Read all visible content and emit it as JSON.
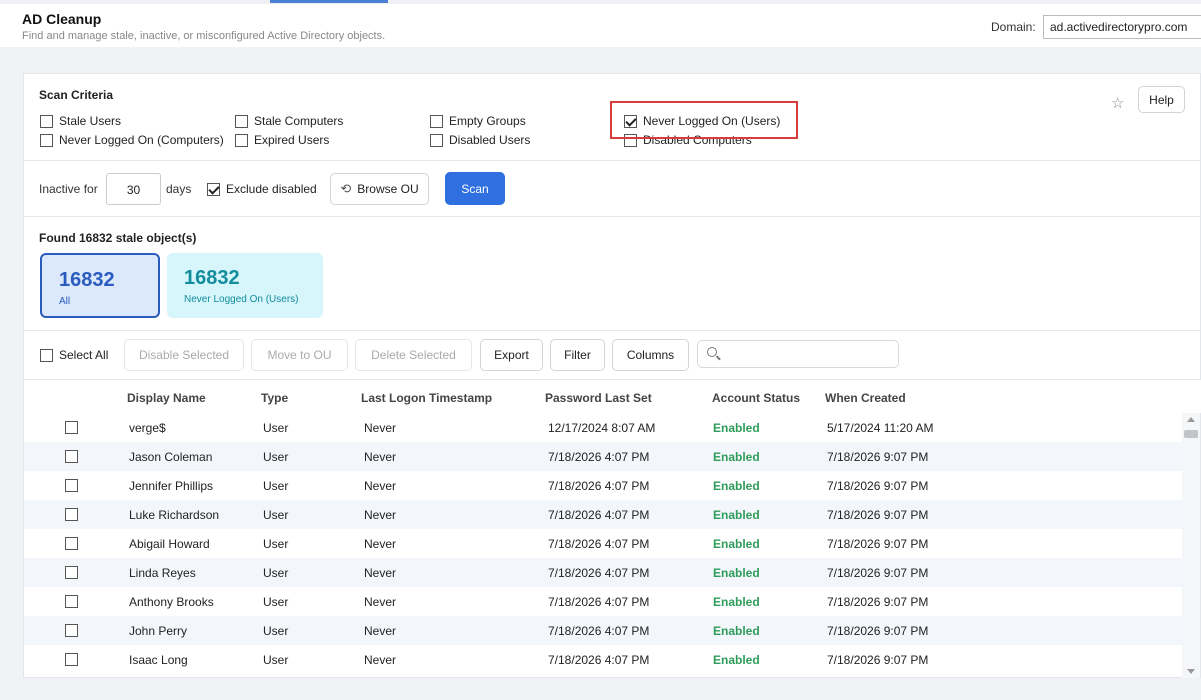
{
  "header": {
    "title": "AD Cleanup",
    "subtitle": "Find and manage stale, inactive, or misconfigured Active Directory objects.",
    "domain_label": "Domain:",
    "domain_value": "ad.activedirectorypro.com"
  },
  "criteria": {
    "title": "Scan Criteria",
    "items": [
      {
        "label": "Stale Users",
        "checked": false
      },
      {
        "label": "Stale Computers",
        "checked": false
      },
      {
        "label": "Empty Groups",
        "checked": false
      },
      {
        "label": "Never Logged On (Users)",
        "checked": true
      },
      {
        "label": "Never Logged On (Computers)",
        "checked": false
      },
      {
        "label": "Expired Users",
        "checked": false
      },
      {
        "label": "Disabled Users",
        "checked": false
      },
      {
        "label": "Disabled Computers",
        "checked": false
      }
    ],
    "help_label": "Help",
    "star_icon": "star-icon"
  },
  "scan": {
    "inactive_label": "Inactive for",
    "days_value": "30",
    "days_label": "days",
    "exclude_disabled_label": "Exclude disabled",
    "exclude_disabled_checked": true,
    "browse_ou_label": "Browse OU",
    "scan_label": "Scan"
  },
  "results": {
    "found_label": "Found 16832 stale object(s)",
    "cards": [
      {
        "count": "16832",
        "label": "All",
        "accent": "#2a5bbf"
      },
      {
        "count": "16832",
        "label": "Never Logged On (Users)",
        "accent": "#138c9e"
      }
    ]
  },
  "toolbar": {
    "select_all_label": "Select All",
    "disable_selected": "Disable Selected",
    "move_to_ou": "Move to OU",
    "delete_selected": "Delete Selected",
    "export": "Export",
    "filter": "Filter",
    "columns": "Columns",
    "search_placeholder": ""
  },
  "table": {
    "columns": [
      "Display Name",
      "Type",
      "Last Logon Timestamp",
      "Password Last Set",
      "Account Status",
      "When Created"
    ],
    "rows": [
      [
        "verge$",
        "User",
        "Never",
        "12/17/2024 8:07 AM",
        "Enabled",
        "5/17/2024 11:20 AM"
      ],
      [
        "Jason Coleman",
        "User",
        "Never",
        "7/18/2026 4:07 PM",
        "Enabled",
        "7/18/2026 9:07 PM"
      ],
      [
        "Jennifer Phillips",
        "User",
        "Never",
        "7/18/2026 4:07 PM",
        "Enabled",
        "7/18/2026 9:07 PM"
      ],
      [
        "Luke Richardson",
        "User",
        "Never",
        "7/18/2026 4:07 PM",
        "Enabled",
        "7/18/2026 9:07 PM"
      ],
      [
        "Abigail Howard",
        "User",
        "Never",
        "7/18/2026 4:07 PM",
        "Enabled",
        "7/18/2026 9:07 PM"
      ],
      [
        "Linda Reyes",
        "User",
        "Never",
        "7/18/2026 4:07 PM",
        "Enabled",
        "7/18/2026 9:07 PM"
      ],
      [
        "Anthony Brooks",
        "User",
        "Never",
        "7/18/2026 4:07 PM",
        "Enabled",
        "7/18/2026 9:07 PM"
      ],
      [
        "John Perry",
        "User",
        "Never",
        "7/18/2026 4:07 PM",
        "Enabled",
        "7/18/2026 9:07 PM"
      ],
      [
        "Isaac Long",
        "User",
        "Never",
        "7/18/2026 4:07 PM",
        "Enabled",
        "7/18/2026 9:07 PM"
      ]
    ]
  }
}
